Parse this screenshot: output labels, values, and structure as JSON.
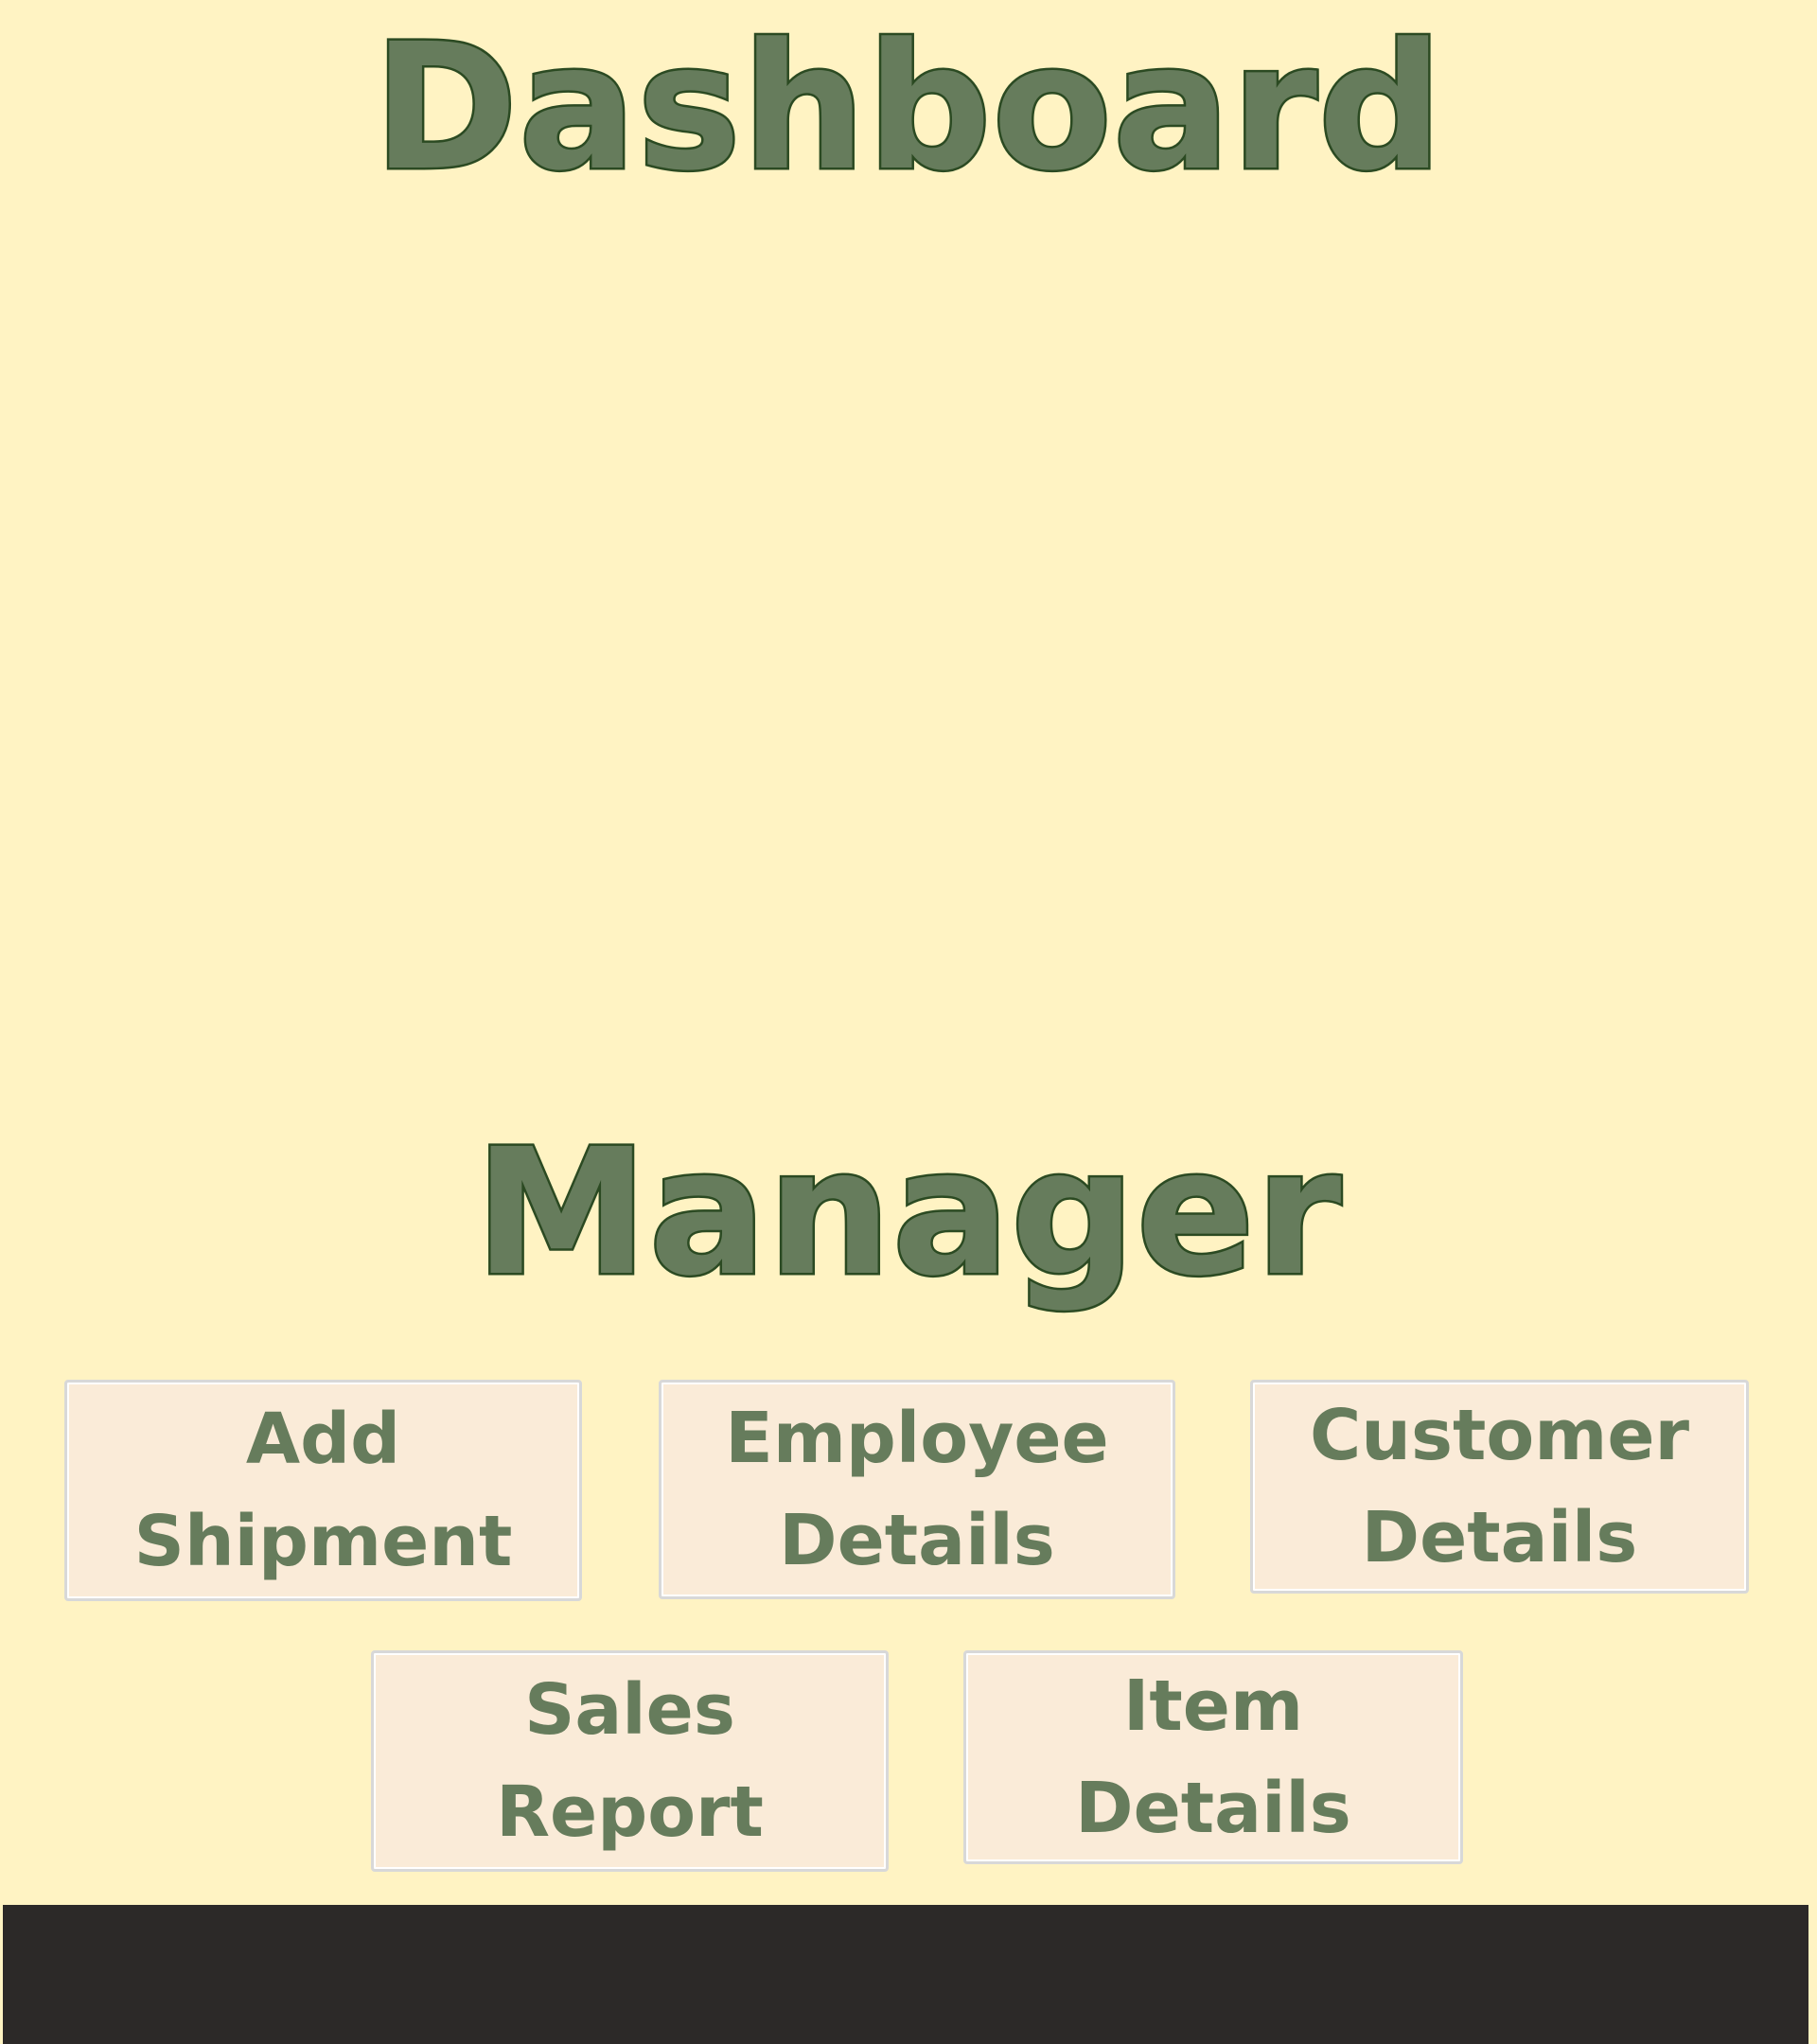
{
  "header": {
    "title": "Dashboard",
    "subtitle": "Manager"
  },
  "menu": {
    "add_shipment": "Add Shipment",
    "employee_details": "Employee Details",
    "customer_details": "Customer Details",
    "sales_report": "Sales Report",
    "item_details": "Item Details"
  },
  "colors": {
    "background": "#fff3c3",
    "title_fill": "#667c5c",
    "title_outline": "#2b4a22",
    "button_background": "#faebd8",
    "button_text": "#667c5c",
    "footer": "#2c2928"
  }
}
